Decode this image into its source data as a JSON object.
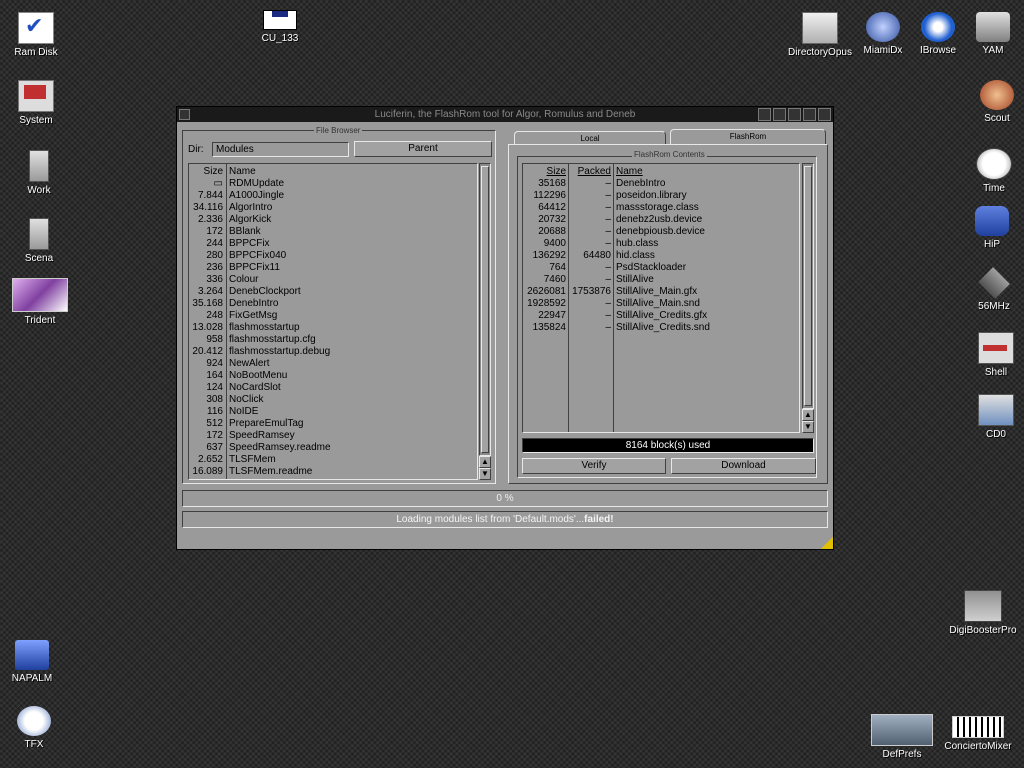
{
  "desktop": {
    "left_icons": [
      {
        "label": "Ram Disk"
      },
      {
        "label": "System"
      },
      {
        "label": "Work"
      },
      {
        "label": "Scena"
      },
      {
        "label": "Trident"
      }
    ],
    "top_icon": {
      "label": "CU_133"
    },
    "right_top_icons": [
      {
        "label": "DirectoryOpus"
      },
      {
        "label": "MiamiDx"
      },
      {
        "label": "IBrowse"
      },
      {
        "label": "YAM"
      }
    ],
    "right_icons": [
      {
        "label": "Scout"
      },
      {
        "label": "Time"
      },
      {
        "label": "HiP"
      },
      {
        "label": "56MHz"
      },
      {
        "label": "Shell"
      },
      {
        "label": "CD0"
      }
    ],
    "digibooster": {
      "label": "DigiBoosterPro"
    },
    "bottom_left_icons": [
      {
        "label": "NAPALM"
      },
      {
        "label": "TFX"
      }
    ],
    "bottom_right_icons": [
      {
        "label": "DefPrefs"
      },
      {
        "label": "ConciertoMixer"
      }
    ]
  },
  "window": {
    "title": "Luciferin, the FlashRom tool for Algor, Romulus and Deneb",
    "file_browser": {
      "group_label": "File Browser",
      "dir_label": "Dir:",
      "dir_value": "Modules",
      "parent_button": "Parent",
      "headers": {
        "size": "Size",
        "name": "Name"
      },
      "rows": [
        {
          "size": "▭",
          "name": "RDMUpdate"
        },
        {
          "size": "7.844",
          "name": "A1000Jingle"
        },
        {
          "size": "34.116",
          "name": "AlgorIntro"
        },
        {
          "size": "2.336",
          "name": "AlgorKick"
        },
        {
          "size": "172",
          "name": "BBlank"
        },
        {
          "size": "244",
          "name": "BPPCFix"
        },
        {
          "size": "280",
          "name": "BPPCFix040"
        },
        {
          "size": "236",
          "name": "BPPCFix11"
        },
        {
          "size": "336",
          "name": "Colour"
        },
        {
          "size": "3.264",
          "name": "DenebClockport"
        },
        {
          "size": "35.168",
          "name": "DenebIntro"
        },
        {
          "size": "248",
          "name": "FixGetMsg"
        },
        {
          "size": "13.028",
          "name": "flashmosstartup"
        },
        {
          "size": "958",
          "name": "flashmosstartup.cfg"
        },
        {
          "size": "20.412",
          "name": "flashmosstartup.debug"
        },
        {
          "size": "924",
          "name": "NewAlert"
        },
        {
          "size": "164",
          "name": "NoBootMenu"
        },
        {
          "size": "124",
          "name": "NoCardSlot"
        },
        {
          "size": "308",
          "name": "NoClick"
        },
        {
          "size": "116",
          "name": "NoIDE"
        },
        {
          "size": "512",
          "name": "PrepareEmulTag"
        },
        {
          "size": "172",
          "name": "SpeedRamsey"
        },
        {
          "size": "637",
          "name": "SpeedRamsey.readme"
        },
        {
          "size": "2.652",
          "name": "TLSFMem"
        },
        {
          "size": "16.089",
          "name": "TLSFMem.readme"
        }
      ]
    },
    "tabs": [
      {
        "label": "Local"
      },
      {
        "label": "FlashRom"
      }
    ],
    "flashrom": {
      "group_label": "FlashRom Contents",
      "headers": {
        "size": "Size",
        "packed": "Packed",
        "name": "Name"
      },
      "rows": [
        {
          "size": "35168",
          "packed": "–",
          "name": "DenebIntro"
        },
        {
          "size": "112296",
          "packed": "–",
          "name": "poseidon.library"
        },
        {
          "size": "64412",
          "packed": "–",
          "name": "massstorage.class"
        },
        {
          "size": "20732",
          "packed": "–",
          "name": "denebz2usb.device"
        },
        {
          "size": "20688",
          "packed": "–",
          "name": "denebpiousb.device"
        },
        {
          "size": "9400",
          "packed": "–",
          "name": "hub.class"
        },
        {
          "size": "136292",
          "packed": "64480",
          "name": "hid.class"
        },
        {
          "size": "764",
          "packed": "–",
          "name": "PsdStackloader"
        },
        {
          "size": "7460",
          "packed": "–",
          "name": "StillAlive"
        },
        {
          "size": "2626081",
          "packed": "1753876",
          "name": "StillAlive_Main.gfx"
        },
        {
          "size": "1928592",
          "packed": "–",
          "name": "StillAlive_Main.snd"
        },
        {
          "size": "22947",
          "packed": "–",
          "name": "StillAlive_Credits.gfx"
        },
        {
          "size": "135824",
          "packed": "–",
          "name": "StillAlive_Credits.snd"
        }
      ],
      "blocks_used": "8164 block(s) used",
      "verify_button": "Verify",
      "download_button": "Download"
    },
    "progress_text": "0 %",
    "status": {
      "prefix": "Loading modules list from 'Default.mods'...",
      "result": "failed!"
    }
  }
}
